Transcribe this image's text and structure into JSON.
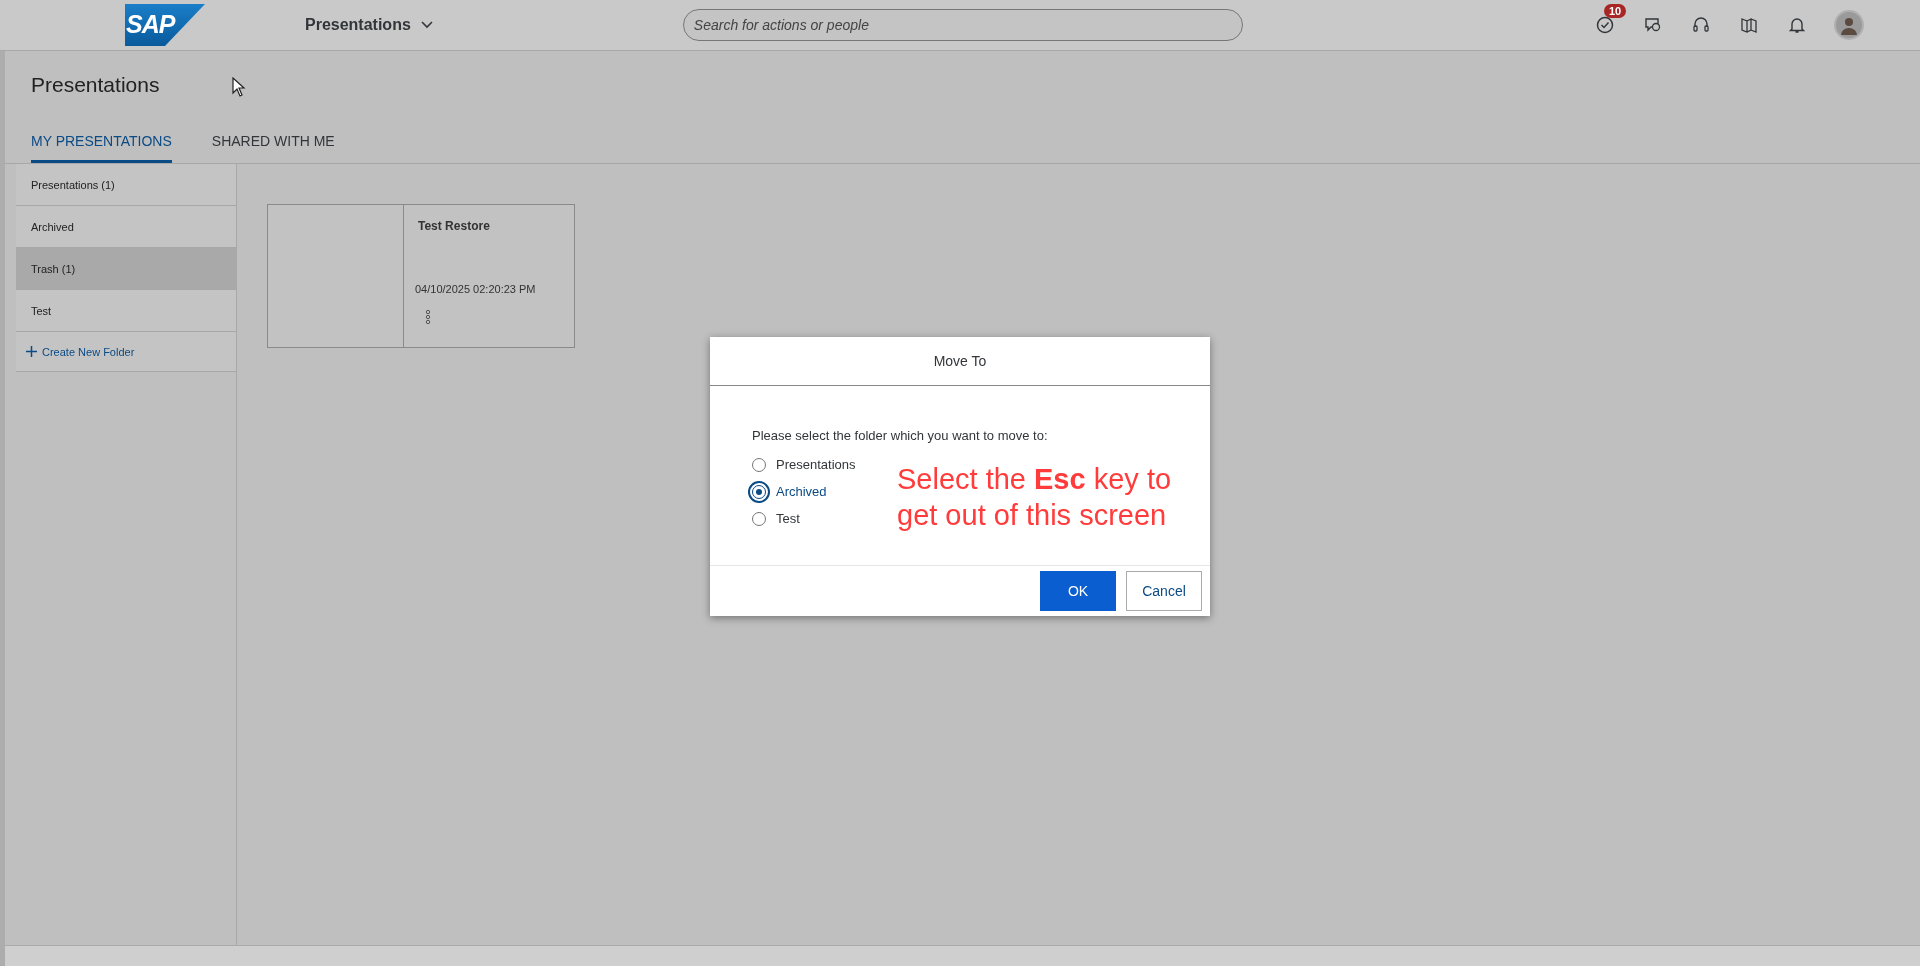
{
  "shell": {
    "logo": "SAP",
    "app_menu": "Presentations",
    "search": {
      "placeholder": "Search for actions or people"
    },
    "notification_badge": "10"
  },
  "page": {
    "title": "Presentations"
  },
  "tabs": [
    {
      "label": "MY PRESENTATIONS",
      "selected": true
    },
    {
      "label": "SHARED WITH ME",
      "selected": false
    }
  ],
  "folders": [
    {
      "label": "Presentations (1)",
      "selected": false
    },
    {
      "label": "Archived",
      "selected": false
    },
    {
      "label": "Trash (1)",
      "selected": true
    },
    {
      "label": "Test",
      "selected": false
    }
  ],
  "create_folder": "Create New Folder",
  "cards": [
    {
      "title": "Test Restore",
      "date": "04/10/2025 02:20:23 PM"
    }
  ],
  "dialog": {
    "title": "Move To",
    "prompt": "Please select the folder which you want to move to:",
    "options": [
      {
        "label": "Presentations",
        "selected": false
      },
      {
        "label": "Archived",
        "selected": true
      },
      {
        "label": "Test",
        "selected": false
      }
    ],
    "buttons": [
      {
        "label": "OK",
        "kind": "primary"
      },
      {
        "label": "Cancel",
        "kind": "secondary"
      }
    ]
  },
  "annotation": "Select the **Esc** key to get out of this screen"
}
